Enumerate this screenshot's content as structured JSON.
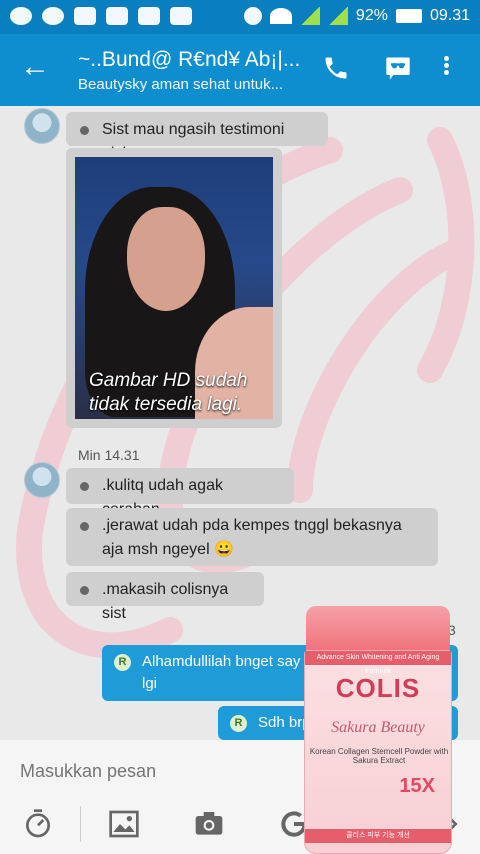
{
  "status_bar": {
    "battery": "92%",
    "time": "09.31"
  },
  "header": {
    "title": "~..Bund@ R€nd¥  Ab¡|...",
    "subtitle": "Beautysky aman sehat untuk...",
    "back_icon": "arrow-left-icon",
    "call_icon": "phone-icon",
    "chat_icon": "video-chat-icon",
    "more_icon": "more-vert-icon"
  },
  "messages": {
    "m1": "Sist mau ngasih testimoni nich..",
    "photo_caption": "Gambar HD sudah tidak tersedia lagi.",
    "time1": "Min 14.31",
    "m2": ".kulitq udah agak cerahan..",
    "m3": ".jerawat udah pda kempes tnggl bekasnya aja msh ngeyel 😀",
    "m4": ".makasih colisnya sist",
    "time2": "3",
    "out1": "Alhamdullilah bnget say testimoni dri colisnya lgi",
    "out2": "Sdh brp",
    "badge": "R"
  },
  "input": {
    "placeholder": "Masukkan pesan"
  },
  "product": {
    "band": "Advance Skin Whitening and Anti Aging Formula",
    "brand": "COLIS",
    "subtitle": "Sakura Beauty",
    "line": "Korean Collagen Stemcell Powder with Sakura Extract",
    "mult": "15X",
    "korean": "콜리스 피부 기능 개선"
  }
}
